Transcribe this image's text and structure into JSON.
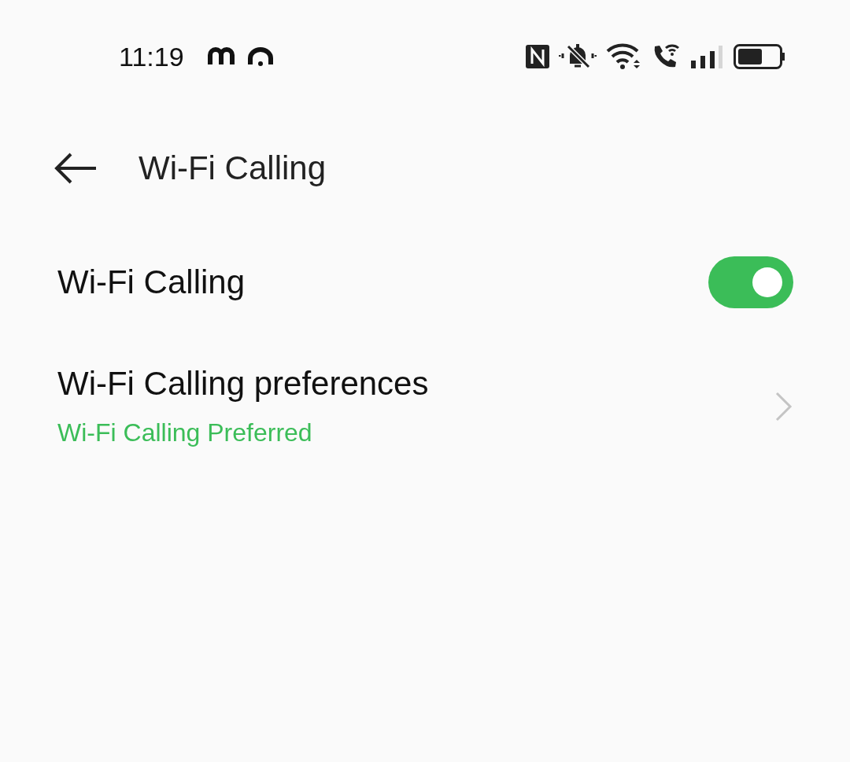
{
  "status_bar": {
    "time": "11:19"
  },
  "header": {
    "title": "Wi-Fi Calling"
  },
  "settings": [
    {
      "kind": "toggle",
      "label": "Wi-Fi Calling",
      "on": true
    },
    {
      "kind": "link",
      "label": "Wi-Fi Calling preferences",
      "value": "Wi-Fi Calling Preferred"
    }
  ]
}
